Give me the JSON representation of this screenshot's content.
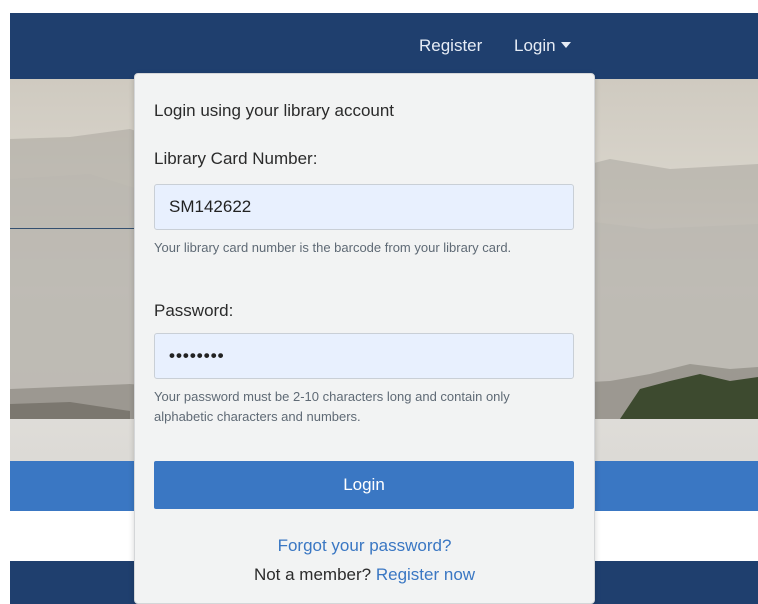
{
  "nav": {
    "register_label": "Register",
    "login_label": "Login"
  },
  "login_form": {
    "heading": "Login using your library account",
    "card_label": "Library Card Number:",
    "card_value": "SM142622",
    "card_help": "Your library card number is the barcode from your library card.",
    "password_label": "Password:",
    "password_value": "passw0rd",
    "password_help": "Your password must be 2-10 characters long and contain only alphabetic characters and numbers.",
    "login_button": "Login",
    "forgot_link": "Forgot your password?",
    "not_member_text": "Not a member?",
    "register_now_link": "Register now"
  },
  "colors": {
    "navbar": "#1f3f6e",
    "accent": "#3a77c3",
    "dropdown_bg": "#f2f3f3",
    "input_bg": "#e8f0fe"
  }
}
